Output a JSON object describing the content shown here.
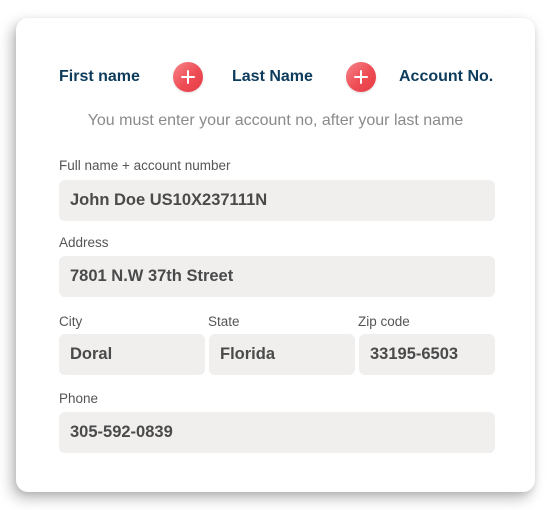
{
  "formula": {
    "first_name": "First name",
    "last_name": "Last Name",
    "account_no": "Account No."
  },
  "note": "You must enter your account no, after your last name",
  "form": {
    "full_name": {
      "label": "Full name + account number",
      "value": "John Doe US10X237111N"
    },
    "address": {
      "label": "Address",
      "value": "7801 N.W 37th Street"
    },
    "city": {
      "label": "City",
      "value": "Doral"
    },
    "state": {
      "label": "State",
      "value": "Florida"
    },
    "zip": {
      "label": "Zip code",
      "value": "33195-6503"
    },
    "phone": {
      "label": "Phone",
      "value": "305-592-0839"
    }
  },
  "colors": {
    "heading": "#0d3b5c",
    "plus_badge": "#ee4d55",
    "field_bg": "#f0efee",
    "note_text": "#8a8a8a"
  },
  "icons": {
    "plus": "plus-icon"
  }
}
